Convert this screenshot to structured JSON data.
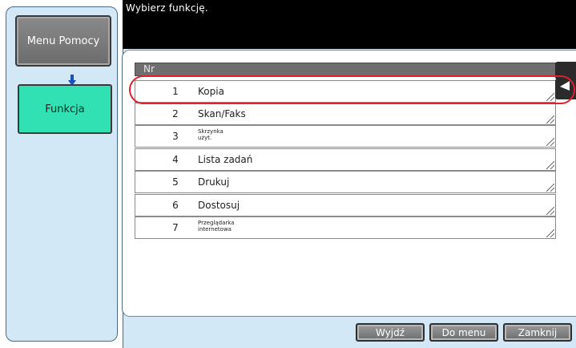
{
  "sidebar": {
    "menu_help_label": "Menu Pomocy",
    "function_label": "Funkcja"
  },
  "header": {
    "prompt": "Wybierz funkcję."
  },
  "table": {
    "column_header": "Nr",
    "rows": [
      {
        "number": "1",
        "label": "Kopia"
      },
      {
        "number": "2",
        "label": "Skan/Faks"
      },
      {
        "number": "3",
        "label_line1": "Skrzynka",
        "label_line2": "użyt."
      },
      {
        "number": "4",
        "label": "Lista zadań"
      },
      {
        "number": "5",
        "label": "Drukuj"
      },
      {
        "number": "6",
        "label": "Dostosuj"
      },
      {
        "number": "7",
        "label_line1": "Przeglądarka",
        "label_line2": "internetowa"
      }
    ],
    "selected_row": "1"
  },
  "footer": {
    "exit_label": "Wyjdź",
    "to_menu_label": "Do menu",
    "close_label": "Zamknij"
  },
  "colors": {
    "highlight": "#e1202a",
    "function_button": "#31e0b3",
    "panel_background": "#d2e8f6"
  }
}
